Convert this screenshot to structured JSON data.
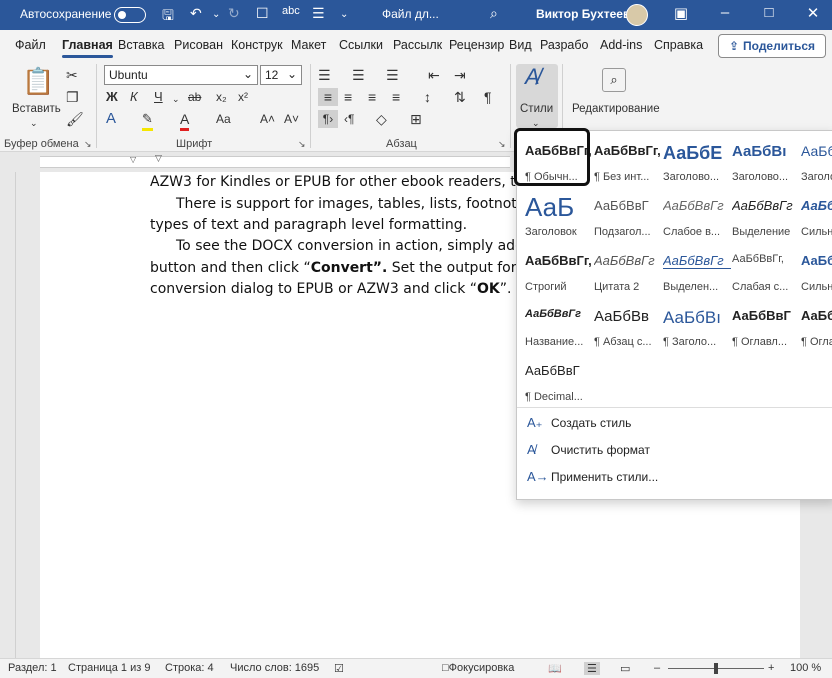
{
  "titlebar": {
    "autosave": "Автосохранение",
    "doc_title": "Файл дл...",
    "user": "Виктор Бухтеев"
  },
  "tabs": [
    "Файл",
    "Главная",
    "Вставка",
    "Рисован",
    "Конструк",
    "Макет",
    "Ссылки",
    "Рассылк",
    "Рецензир",
    "Вид",
    "Разрабо",
    "Add-ins",
    "Справка"
  ],
  "share": "Поделиться",
  "ribbon": {
    "paste": "Вставить",
    "font_name": "Ubuntu",
    "font_size": "12",
    "groups": {
      "clipboard": "Буфер обмена",
      "font": "Шрифт",
      "paragraph": "Абзац"
    },
    "styles": "Стили",
    "editing": "Редактирование"
  },
  "document": {
    "lines": [
      "AZW3 for Kindles or EPUB for other ebook readers, to see it",
      "There is support for images, tables, lists, footnotes, end",
      "types of text and paragraph level formatting.",
      "To see the DOCX conversion in action, simply add this f",
      "button and then click “",
      "Convert”.",
      "  Set the output format in t",
      "conversion dialog to EPUB or AZW3 and click “",
      "OK",
      "”."
    ]
  },
  "styles_gallery": {
    "rows": [
      [
        {
          "s": "АаБбВвГг,",
          "n": "¶ Обычн..."
        },
        {
          "s": "АаБбВвГг,",
          "n": "¶ Без инт..."
        },
        {
          "s": "АаБбЕ",
          "n": "Заголово..."
        },
        {
          "s": "АаБбВı",
          "n": "Заголово..."
        },
        {
          "s": "АаБб",
          "n": "Заголо..."
        }
      ],
      [
        {
          "s": "АаБ",
          "n": "Заголовок"
        },
        {
          "s": "АаБбВвГ",
          "n": "Подзагол..."
        },
        {
          "s": "АаБбВвГг",
          "n": "Слабое в..."
        },
        {
          "s": "АаБбВвГг",
          "n": "Выделение"
        },
        {
          "s": "АаБб",
          "n": "Сильн..."
        }
      ],
      [
        {
          "s": "АаБбВвГг,",
          "n": "Строгий"
        },
        {
          "s": "АаБбВвГг",
          "n": "Цитата 2"
        },
        {
          "s": "АаБбВвГг",
          "n": "Выделен..."
        },
        {
          "s": "АаБбВвГг,",
          "n": "Слабая с..."
        },
        {
          "s": "АаБбВ",
          "n": "Сильн..."
        }
      ],
      [
        {
          "s": "АаБбВвГг",
          "n": "Название..."
        },
        {
          "s": "АаБбВв",
          "n": "¶ Абзац с..."
        },
        {
          "s": "АаБбВı",
          "n": "¶ Заголо..."
        },
        {
          "s": "АаБбВвГ",
          "n": "¶ Оглавл..."
        },
        {
          "s": "АаБб",
          "n": "¶ Огла..."
        }
      ],
      [
        {
          "s": "АаБбВвГ",
          "n": "¶ Decimal..."
        }
      ]
    ],
    "actions": [
      "Создать стиль",
      "Очистить формат",
      "Применить стили..."
    ]
  },
  "statusbar": {
    "section": "Раздел: 1",
    "page": "Страница 1 из 9",
    "line": "Строка: 4",
    "words": "Число слов: 1695",
    "focus": "Фокусировка",
    "zoom": "100 %"
  }
}
